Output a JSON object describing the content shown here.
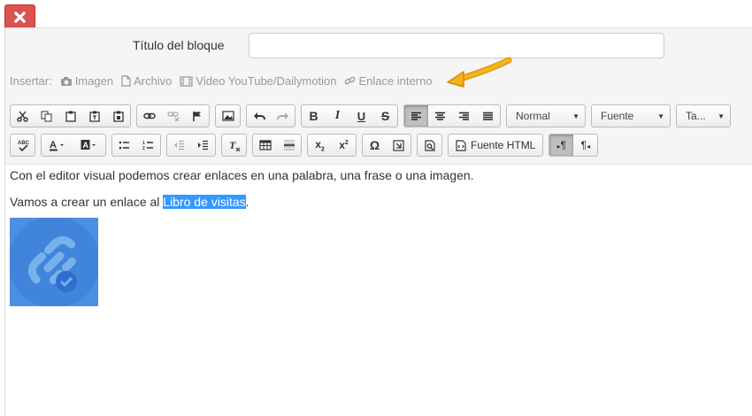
{
  "dialog": {
    "close_icon": "close-icon",
    "close_color": "#d9534f"
  },
  "form": {
    "title_label": "Título del bloque",
    "title_value": "",
    "title_placeholder": ""
  },
  "insert": {
    "label": "Insertar:",
    "items": [
      {
        "icon": "camera-icon",
        "label": "Imagen"
      },
      {
        "icon": "file-icon",
        "label": "Archivo"
      },
      {
        "icon": "film-icon",
        "label": "Video YouTube/Dailymotion"
      },
      {
        "icon": "link-icon",
        "label": "Enlace interno"
      }
    ],
    "arrow_color": "#f0a30a"
  },
  "toolbar": {
    "format_value": "Normal",
    "font_value": "Fuente",
    "size_value": "Ta...",
    "source_label": "Fuente HTML",
    "ltr_label": "¶",
    "rtl_label": "¶"
  },
  "editor": {
    "paragraph1": "Con el editor visual podemos crear enlaces en una palabra, una frase o una imagen.",
    "paragraph2_before": "Vamos a crear un enlace al ",
    "paragraph2_selected": "Libro de visitas",
    "paragraph2_after": ".",
    "image_icon": "link-check-icon",
    "image_color": "#4a90e2"
  }
}
